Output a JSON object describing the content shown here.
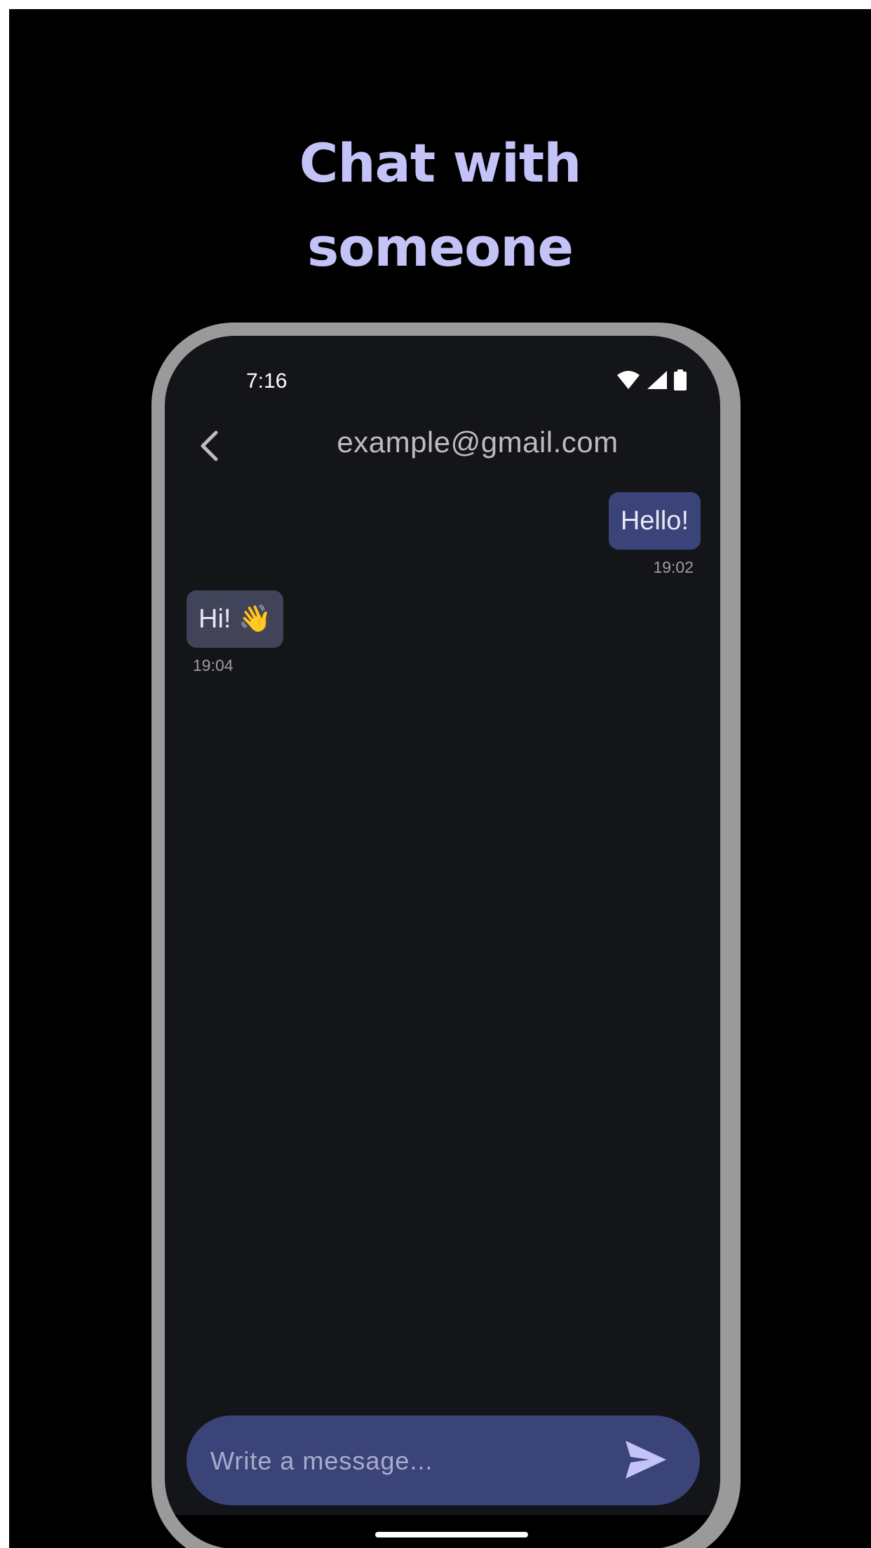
{
  "promo": {
    "headline_line1": "Chat with",
    "headline_line2": "someone"
  },
  "status_bar": {
    "time": "7:16",
    "icons": [
      "wifi-icon",
      "signal-icon",
      "battery-icon"
    ]
  },
  "header": {
    "back_icon": "chevron-left-icon",
    "title": "example@gmail.com"
  },
  "messages": [
    {
      "direction": "sent",
      "text": "Hello!",
      "time": "19:02"
    },
    {
      "direction": "received",
      "text": "Hi!",
      "emoji": "👋",
      "time": "19:04"
    }
  ],
  "composer": {
    "placeholder": "Write a message...",
    "send_icon": "send-icon"
  },
  "colors": {
    "background": "#000000",
    "headline": "#c3c3f7",
    "phone_frame": "#9a9a9a",
    "screen": "#141519",
    "sent_bubble": "#3b4479",
    "received_bubble": "#414358",
    "composer": "#3b4479",
    "send_icon": "#c3c3f7"
  }
}
